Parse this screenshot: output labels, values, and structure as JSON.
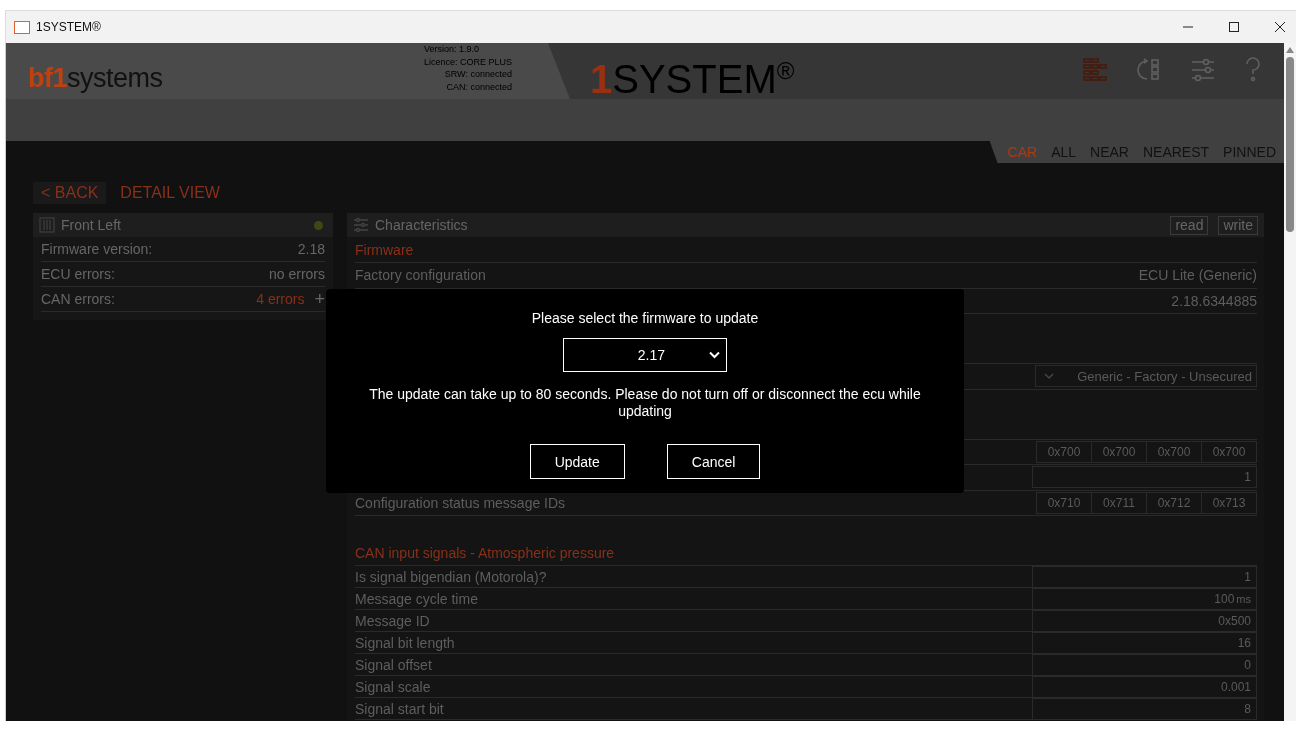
{
  "window": {
    "title": "1SYSTEM®"
  },
  "header": {
    "logo": {
      "prefix": "bf1",
      "suffix": "systems"
    },
    "info": [
      "Version: 1.9.0",
      "Licence: CORE PLUS",
      "SRW: connected",
      "CAN: connected"
    ],
    "brand": {
      "mark": "1",
      "name": "SYSTEM$^{®}$"
    },
    "tools": [
      {
        "kind": "grid",
        "selected": true
      },
      {
        "kind": "refresh",
        "selected": false
      },
      {
        "kind": "sliders",
        "selected": false
      },
      {
        "kind": "help",
        "selected": false
      }
    ]
  },
  "tabs": [
    {
      "label": "CAR",
      "selected": true
    },
    {
      "label": "ALL",
      "selected": false
    },
    {
      "label": "NEAR",
      "selected": false
    },
    {
      "label": "NEAREST",
      "selected": false
    },
    {
      "label": "PINNED",
      "selected": false
    }
  ],
  "back_button": "< BACK",
  "page_title": "DETAIL VIEW",
  "device": {
    "title": "Front Left",
    "color": "#3b4a12",
    "rows": [
      {
        "label": "Firmware version:",
        "value": "2.18",
        "alert": false
      },
      {
        "label": "ECU errors:",
        "value": "no errors",
        "alert": false
      },
      {
        "label": "CAN errors:",
        "value": "4 errors",
        "alert": true,
        "expand": "+"
      }
    ]
  },
  "characteristics": {
    "title": "Characteristics",
    "actions": [
      "read",
      "write"
    ],
    "sections": [
      {
        "title": "Firmware",
        "rows": [
          {
            "kind": "text",
            "label": "Factory configuration",
            "value": "ECU Lite (Generic)"
          },
          {
            "kind": "text",
            "value": "2.18.6344885"
          }
        ]
      },
      {
        "rows": [
          {
            "kind": "select",
            "value": "Generic - Factory - Unsecured"
          }
        ]
      },
      {
        "rows": [
          {
            "kind": "cells",
            "cells": [
              "0x700",
              "0x700",
              "0x700",
              "0x700"
            ]
          },
          {
            "kind": "input",
            "value": "1"
          },
          {
            "kind": "cells",
            "label": "Configuration status message IDs",
            "cells": [
              "0x710",
              "0x711",
              "0x712",
              "0x713"
            ]
          }
        ]
      },
      {
        "title": "CAN input signals - Atmospheric pressure",
        "rows": [
          {
            "kind": "input",
            "label": "Is signal bigendian (Motorola)?",
            "value": "1"
          },
          {
            "kind": "input",
            "label": "Message cycle time",
            "value": "100",
            "unit": "ms"
          },
          {
            "kind": "input",
            "label": "Message ID",
            "value": "0x500"
          },
          {
            "kind": "input",
            "label": "Signal bit length",
            "value": "16"
          },
          {
            "kind": "input",
            "label": "Signal offset",
            "value": "0"
          },
          {
            "kind": "input",
            "label": "Signal scale",
            "value": "0.001"
          },
          {
            "kind": "input",
            "label": "Signal start bit",
            "value": "8"
          }
        ]
      }
    ]
  },
  "dialog": {
    "title": "Please select the firmware to update",
    "selected_version": "2.17",
    "message": "The update can take up to 80 seconds. Please do not turn off or disconnect the ecu while updating",
    "buttons": [
      "Update",
      "Cancel"
    ]
  }
}
